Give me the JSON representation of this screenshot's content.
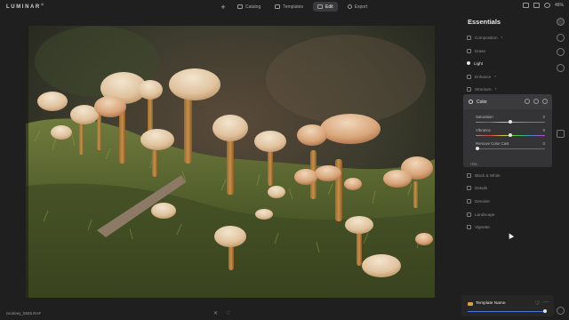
{
  "app": {
    "logo": "LUMINAR",
    "logo_sup": "AI"
  },
  "topbar": {
    "add_symbol": "+",
    "tabs": [
      {
        "label": "Catalog",
        "icon": "catalog-icon",
        "active": false
      },
      {
        "label": "Templates",
        "icon": "templates-icon",
        "active": false
      },
      {
        "label": "Edit",
        "icon": "edit-icon",
        "active": true
      },
      {
        "label": "Export",
        "icon": "export-icon",
        "active": false
      }
    ],
    "zoom": "46%"
  },
  "photo": {
    "filename": "nicoleey_5925.RAF",
    "subject": "mushrooms-on-moss"
  },
  "panel": {
    "title": "Essentials",
    "tools": [
      {
        "label": "Composition",
        "icon": "composition-icon",
        "active": false
      },
      {
        "label": "Erase",
        "icon": "erase-icon",
        "active": false
      },
      {
        "label": "Light",
        "icon": "light-icon",
        "active": true
      },
      {
        "label": "Enhance",
        "icon": "enhance-icon",
        "active": false
      },
      {
        "label": "Structure",
        "icon": "structure-icon",
        "active": false
      }
    ],
    "color": {
      "title": "Color",
      "sliders": [
        {
          "label": "Saturation",
          "value": "0",
          "position": 0.5
        },
        {
          "label": "Vibrance",
          "value": "0",
          "position": 0.5
        },
        {
          "label": "Remove Color Cast",
          "value": "0",
          "position": 0.0
        }
      ],
      "hsl_label": "HSL"
    },
    "tools_after": [
      {
        "label": "Black & White",
        "icon": "bw-icon"
      },
      {
        "label": "Details",
        "icon": "details-icon"
      },
      {
        "label": "Denoise",
        "icon": "denoise-icon"
      },
      {
        "label": "Landscape",
        "icon": "landscape-icon"
      },
      {
        "label": "Vignette",
        "icon": "vignette-icon"
      }
    ]
  },
  "template_bar": {
    "name": "Template Name",
    "heart": "♡",
    "more": "···",
    "amount": 1.0
  },
  "colors": {
    "accent": "#4a78d8",
    "background": "#1f1f20",
    "panel": "#343436"
  }
}
